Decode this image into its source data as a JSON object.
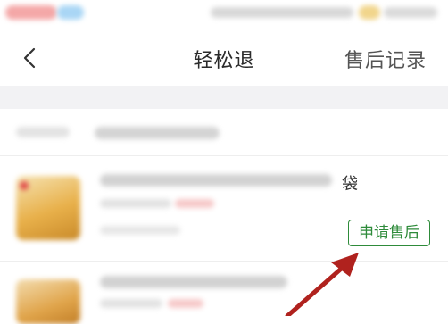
{
  "header": {
    "title": "轻松退",
    "record_label": "售后记录"
  },
  "item": {
    "partial_text": "袋",
    "after_sale_button": "申请售后"
  },
  "colors": {
    "accent_green": "#2e8b3a",
    "annotation_arrow": "#b0221e"
  }
}
